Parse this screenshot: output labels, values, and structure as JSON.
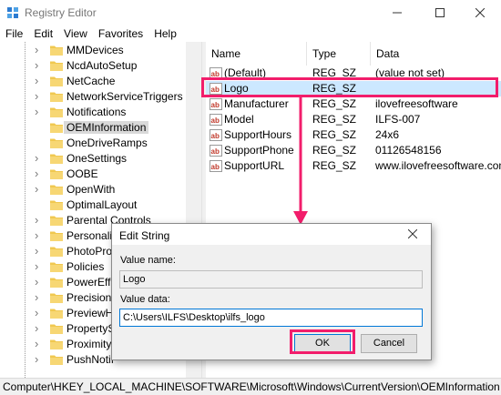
{
  "window": {
    "title": "Registry Editor"
  },
  "menu": [
    "File",
    "Edit",
    "View",
    "Favorites",
    "Help"
  ],
  "tree": {
    "items": [
      {
        "label": "MMDevices",
        "expander": true
      },
      {
        "label": "NcdAutoSetup",
        "expander": true
      },
      {
        "label": "NetCache",
        "expander": true
      },
      {
        "label": "NetworkServiceTriggers",
        "expander": true
      },
      {
        "label": "Notifications",
        "expander": true
      },
      {
        "label": "OEMInformation",
        "expander": false,
        "selected": true
      },
      {
        "label": "OneDriveRamps",
        "expander": false
      },
      {
        "label": "OneSettings",
        "expander": true
      },
      {
        "label": "OOBE",
        "expander": true
      },
      {
        "label": "OpenWith",
        "expander": true
      },
      {
        "label": "OptimalLayout",
        "expander": false
      },
      {
        "label": "Parental Controls",
        "expander": true
      },
      {
        "label": "Personaliz",
        "expander": true
      },
      {
        "label": "PhotoProp",
        "expander": true
      },
      {
        "label": "Policies",
        "expander": true
      },
      {
        "label": "PowerEffic",
        "expander": true
      },
      {
        "label": "PrecisionT",
        "expander": true
      },
      {
        "label": "PreviewHa",
        "expander": true
      },
      {
        "label": "PropertySy",
        "expander": true
      },
      {
        "label": "Proximity",
        "expander": true
      },
      {
        "label": "PushNotif",
        "expander": true
      }
    ]
  },
  "values": {
    "headers": {
      "name": "Name",
      "type": "Type",
      "data": "Data"
    },
    "rows": [
      {
        "name": "(Default)",
        "type": "REG_SZ",
        "data": "(value not set)"
      },
      {
        "name": "Logo",
        "type": "REG_SZ",
        "data": "",
        "highlight": true
      },
      {
        "name": "Manufacturer",
        "type": "REG_SZ",
        "data": "ilovefreesoftware"
      },
      {
        "name": "Model",
        "type": "REG_SZ",
        "data": "ILFS-007"
      },
      {
        "name": "SupportHours",
        "type": "REG_SZ",
        "data": "24x6"
      },
      {
        "name": "SupportPhone",
        "type": "REG_SZ",
        "data": "01126548156"
      },
      {
        "name": "SupportURL",
        "type": "REG_SZ",
        "data": "www.ilovefreesoftware.com"
      }
    ]
  },
  "status": {
    "path": "Computer\\HKEY_LOCAL_MACHINE\\SOFTWARE\\Microsoft\\Windows\\CurrentVersion\\OEMInformation"
  },
  "dialog": {
    "title": "Edit String",
    "value_name_label": "Value name:",
    "value_name": "Logo",
    "value_data_label": "Value data:",
    "value_data": "C:\\Users\\ILFS\\Desktop\\ilfs_logo",
    "ok_label": "OK",
    "cancel_label": "Cancel"
  },
  "colors": {
    "annotation": "#f21d6b",
    "selection": "#cce8ff",
    "folder": "#f0c850"
  }
}
